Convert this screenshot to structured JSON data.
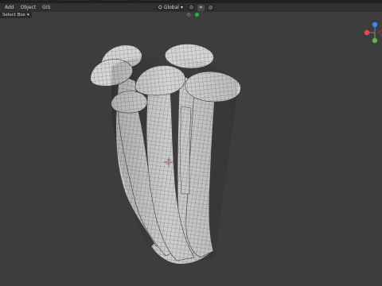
{
  "header": {
    "menu": [
      "Add",
      "Object",
      "GIS"
    ],
    "orientation": {
      "label": "Global"
    },
    "icons": [
      "pivot-icon",
      "snap-icon",
      "proportional-edit-icon"
    ]
  },
  "toolbar": {
    "select_box": {
      "label": "Select Box"
    }
  },
  "gizmo": {
    "axes": [
      {
        "axis": "y",
        "color": "#3b8cf0"
      },
      {
        "axis": "x",
        "color": "#e34b5a"
      },
      {
        "axis": "z",
        "color": "#62b34a"
      }
    ]
  },
  "viewport": {
    "background": "#3d3d3d",
    "object": "enoki-mushroom-cluster-wireframe"
  }
}
